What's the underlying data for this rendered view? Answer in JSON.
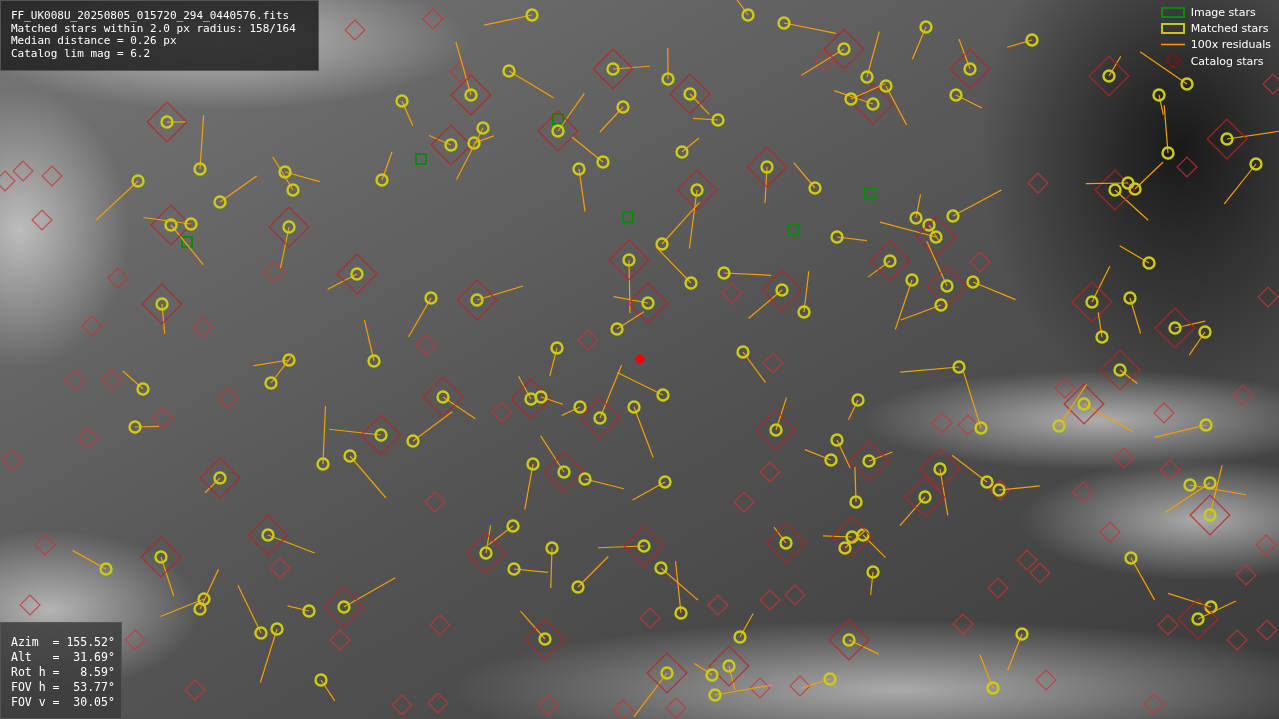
{
  "info": {
    "lines": [
      "FF_UK008U_20250805_015720_294_0440576.fits",
      "Matched stars within 2.0 px radius: 158/164",
      "Median distance = 0.26 px",
      "Catalog lim mag = 6.2"
    ]
  },
  "legend": {
    "items": [
      {
        "label": "Image stars"
      },
      {
        "label": "Matched stars",
        "kind": "matched"
      },
      {
        "label": "100x residuals",
        "kind": "residual"
      },
      {
        "label": "Catalog stars",
        "kind": "catalog"
      }
    ]
  },
  "pointing": {
    "lines": [
      "Azim  = 155.52°",
      "Alt   =  31.69°",
      "Rot h =   8.59°",
      "FOV h =  53.77°",
      "FOV v =  30.05°"
    ]
  }
}
